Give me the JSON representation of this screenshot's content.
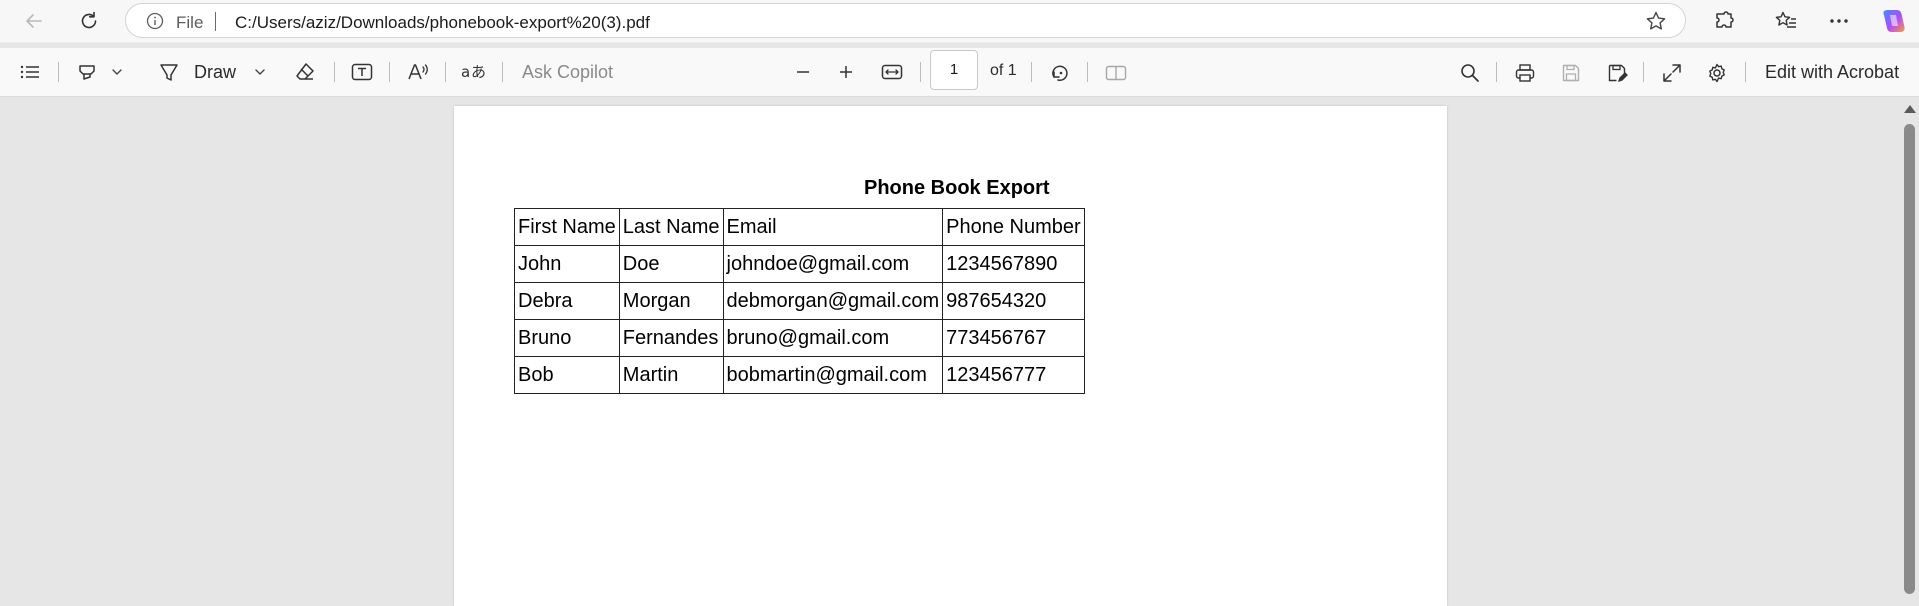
{
  "browser": {
    "back_icon": "arrow-left-icon",
    "refresh_icon": "refresh-icon",
    "omnibox": {
      "scheme_label": "File",
      "url": "C:/Users/aziz/Downloads/phonebook-export%20(3).pdf"
    }
  },
  "pdf_toolbar": {
    "draw_label": "Draw",
    "ask_copilot_label": "Ask Copilot",
    "page_number": "1",
    "page_total": "of 1",
    "edit_acrobat_label": "Edit with Acrobat"
  },
  "document": {
    "title": "Phone Book Export",
    "table": {
      "headers": [
        "First Name",
        "Last Name",
        "Email",
        "Phone Number"
      ],
      "rows": [
        [
          "John",
          "Doe",
          "johndoe@gmail.com",
          "1234567890"
        ],
        [
          "Debra",
          "Morgan",
          "debmorgan@gmail.com",
          "987654320"
        ],
        [
          "Bruno",
          "Fernandes",
          "bruno@gmail.com",
          "773456767"
        ],
        [
          "Bob",
          "Martin",
          "bobmartin@gmail.com",
          "123456777"
        ]
      ]
    }
  },
  "colors": {
    "copilot_gradient": [
      "#3f8cff",
      "#b04cff",
      "#ff9a3c"
    ]
  }
}
